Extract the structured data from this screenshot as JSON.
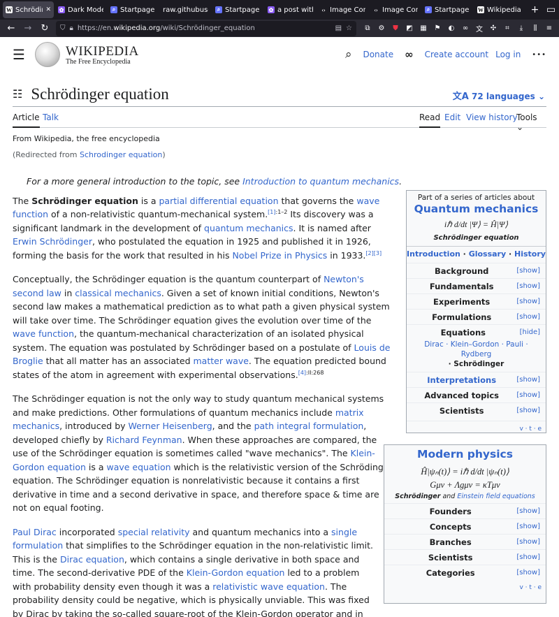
{
  "browser": {
    "tabs": [
      {
        "label": "Schrödinger",
        "icon": "wikipedia-icon",
        "active": true
      },
      {
        "label": "Dark Mode",
        "icon": "purple-app-icon",
        "active": false
      },
      {
        "label": "Startpage Se",
        "icon": "startpage-icon",
        "active": false
      },
      {
        "label": "raw.githubuser",
        "icon": "",
        "active": false
      },
      {
        "label": "Startpage Se",
        "icon": "startpage-icon",
        "active": false
      },
      {
        "label": "a post with",
        "icon": "purple-app-icon",
        "active": false
      },
      {
        "label": "Image Comp",
        "icon": "code-icon",
        "active": false
      },
      {
        "label": "Image Comp",
        "icon": "code-icon",
        "active": false
      },
      {
        "label": "Startpage Se",
        "icon": "startpage-icon",
        "active": false
      },
      {
        "label": "Wikipedia",
        "icon": "wikipedia-icon",
        "active": false
      }
    ],
    "close_label": "✕",
    "new_tab_label": "+",
    "url_prefix": "https://en.",
    "url_host": "wikipedia.org",
    "url_path": "/wiki/Schrödinger_equation"
  },
  "wiki": {
    "logo_title": "WIKIPEDIA",
    "logo_subtitle": "The Free Encyclopedia",
    "donate": "Donate",
    "create_account": "Create account",
    "login": "Log in",
    "more": "•••",
    "page_title": "Schrödinger equation",
    "languages": "72 languages",
    "tab_article": "Article",
    "tab_talk": "Talk",
    "tab_read": "Read",
    "tab_edit": "Edit",
    "tab_history": "View history",
    "tab_tools": "Tools"
  },
  "article": {
    "from": "From Wikipedia, the free encyclopedia",
    "redirected_pre": "(Redirected from ",
    "redirected_link": "Schrodinger equation",
    "redirected_post": ")",
    "hatnote_pre": "For a more general introduction to the topic, see ",
    "hatnote_link": "Introduction to quantum mechanics",
    "hatnote_post": "."
  },
  "infobox1": {
    "series": "Part of a series of articles about",
    "title": "Quantum mechanics",
    "equation": "iℏ d/dt |Ψ⟩ = Ĥ|Ψ⟩",
    "caption": "Schrödinger equation",
    "nav": [
      "Introduction",
      "Glossary",
      "History"
    ],
    "rows": [
      {
        "label": "Background",
        "action": "[show]"
      },
      {
        "label": "Fundamentals",
        "action": "[show]"
      },
      {
        "label": "Experiments",
        "action": "[show]"
      },
      {
        "label": "Formulations",
        "action": "[show]"
      },
      {
        "label": "Equations",
        "action": "[hide]"
      }
    ],
    "equations_list": "Dirac · Klein–Gordon · Pauli · Rydberg",
    "equations_current": "· Schrödinger",
    "rows2": [
      {
        "label": "Interpretations",
        "action": "[show]",
        "link": true
      },
      {
        "label": "Advanced topics",
        "action": "[show]",
        "link": false
      },
      {
        "label": "Scientists",
        "action": "[show]",
        "link": false
      }
    ],
    "vte": "v · t · e"
  },
  "infobox2": {
    "title": "Modern physics",
    "equation1": "Ĥ|ψₙ(t)⟩ = iℏ d/dt |ψₙ(t)⟩",
    "equation2": "Gμν + Λgμν = κTμν",
    "caption_a": "Schrödinger",
    "caption_and": " and ",
    "caption_b": "Einstein field equations",
    "rows": [
      {
        "label": "Founders",
        "action": "[show]"
      },
      {
        "label": "Concepts",
        "action": "[show]"
      },
      {
        "label": "Branches",
        "action": "[show]"
      },
      {
        "label": "Scientists",
        "action": "[show]"
      },
      {
        "label": "Categories",
        "action": "[show]"
      }
    ],
    "vte": "v · t · e"
  },
  "colors": {
    "link": "#3366cc",
    "tabbar": "#1c1b22",
    "navbar": "#2b2a33"
  }
}
